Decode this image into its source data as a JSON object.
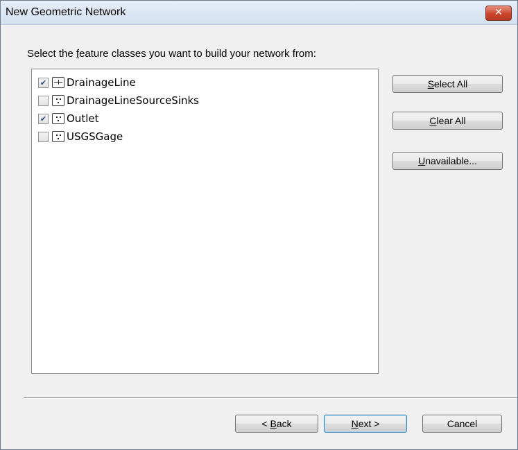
{
  "window": {
    "title": "New Geometric Network",
    "close_label": "✕"
  },
  "prompt": {
    "before": "Select the ",
    "mnemonic": "f",
    "after": "eature classes you want to build your network from:"
  },
  "feature_classes": [
    {
      "label": "DrainageLine",
      "checked": true,
      "icon": "line-feature-icon"
    },
    {
      "label": "DrainageLineSourceSinks",
      "checked": false,
      "icon": "point-feature-icon"
    },
    {
      "label": "Outlet",
      "checked": true,
      "icon": "point-feature-icon"
    },
    {
      "label": "USGSGage",
      "checked": false,
      "icon": "point-feature-icon"
    }
  ],
  "side_buttons": {
    "select_all": {
      "mnemonic": "S",
      "rest": "elect All"
    },
    "clear_all": {
      "mnemonic": "C",
      "rest": "lear All"
    },
    "unavailable": {
      "mnemonic": "U",
      "rest": "navailable..."
    }
  },
  "footer_buttons": {
    "back": {
      "prefix": "< ",
      "mnemonic": "B",
      "rest": "ack"
    },
    "next": {
      "mnemonic": "N",
      "rest": "ext >"
    },
    "cancel": {
      "label": "Cancel"
    }
  },
  "colors": {
    "accent": "#3c7fb1",
    "close": "#c9452b",
    "check": "#233f7a"
  }
}
